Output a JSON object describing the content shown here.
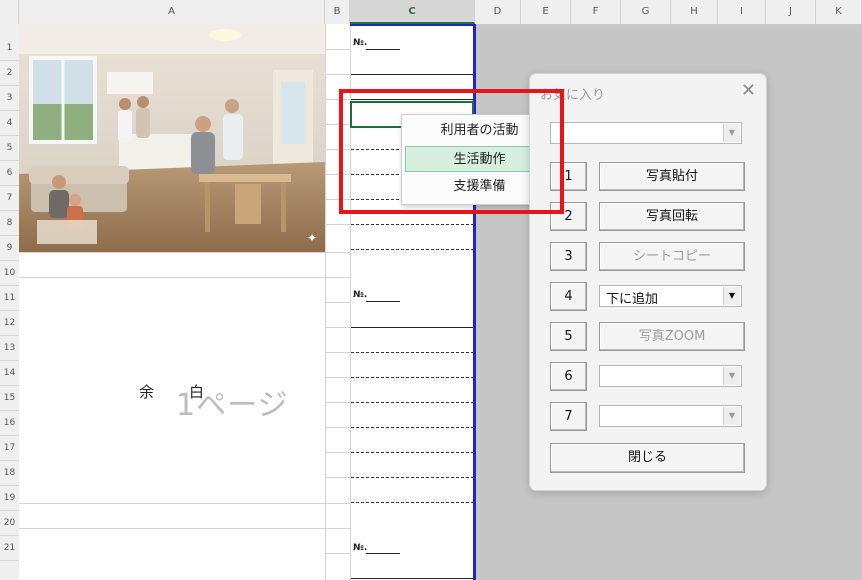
{
  "columns": [
    "A",
    "B",
    "C",
    "D",
    "E",
    "F",
    "G",
    "H",
    "I",
    "J",
    "K"
  ],
  "selected_column": "C",
  "rows": [
    "1",
    "2",
    "3",
    "4",
    "5",
    "6",
    "7",
    "8",
    "9",
    "10",
    "11",
    "12",
    "13",
    "14",
    "15",
    "16",
    "17",
    "18",
    "19",
    "20",
    "21"
  ],
  "sheet": {
    "small_marks": [
      "№.",
      "№.",
      "№."
    ],
    "page_block": {
      "yohaku_left": "余",
      "yohaku_right": "白",
      "page_label": "1ページ"
    }
  },
  "context_menu": {
    "items": [
      "利用者の活動",
      "生活動作",
      "支援準備"
    ],
    "highlighted_index": 1
  },
  "dialog": {
    "title": "お気に入り",
    "close_glyph": "✕",
    "top_combo_value": "",
    "numbers": [
      "1",
      "2",
      "3",
      "4",
      "5",
      "6",
      "7"
    ],
    "buttons": {
      "b1": "写真貼付",
      "b2": "写真回転",
      "b3": "シートコピー",
      "b5": "写真ZOOM"
    },
    "combo4_value": "下に追加",
    "combo6_value": "",
    "combo7_value": "",
    "close_button": "閉じる"
  },
  "colors": {
    "highlight_red": "#e8141b",
    "print_border_blue": "#1f25c9",
    "excel_green": "#217346",
    "menu_highlight": "#d6efdf"
  }
}
